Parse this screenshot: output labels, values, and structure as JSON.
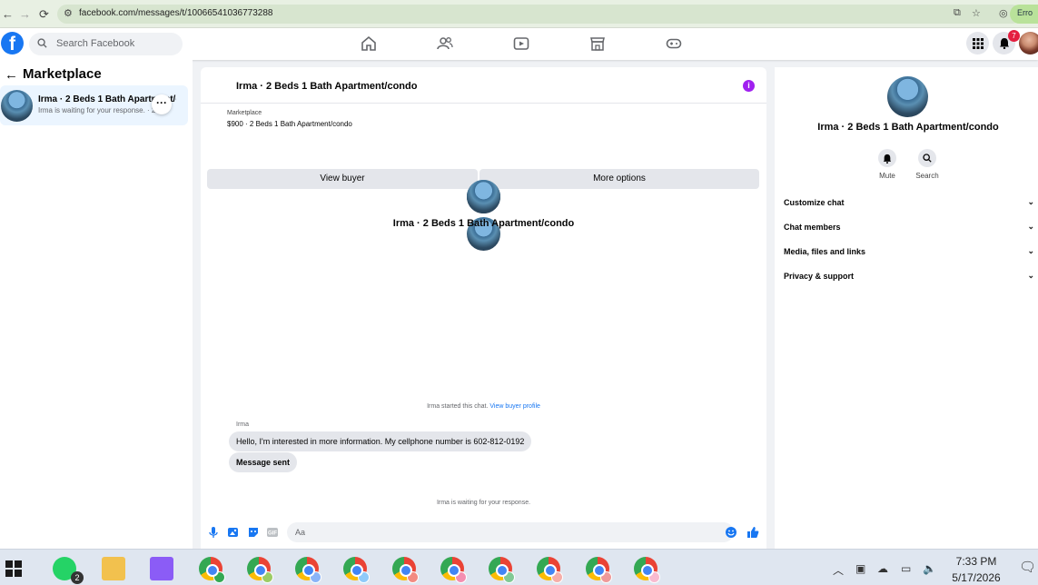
{
  "browser": {
    "url": "facebook.com/messages/t/100665410367732​88",
    "error_chip": "Erro"
  },
  "facebook": {
    "search_placeholder": "Search Facebook",
    "notification_count": "7"
  },
  "sidebar": {
    "title": "Marketplace",
    "conversation": {
      "title": "Irma · 2 Beds 1 Bath Apartment/condo",
      "preview": "Irma is waiting for your response. · 2d"
    }
  },
  "chat": {
    "header_title": "Irma · 2 Beds 1 Bath Apartment/condo",
    "listing_source": "Marketplace",
    "listing_price": "$900 · 2 Beds 1 Bath Apartment/condo",
    "view_buyer_label": "View buyer",
    "more_options_label": "More options",
    "profile_name": "Irma · 2 Beds 1 Bath Apartment/condo",
    "started_text": "Irma started this chat.",
    "view_buyer_profile_link": "View buyer profile",
    "sender_name": "Irma",
    "message_1": "Hello, I'm interested in more information. My cellphone number is 602-812-0192",
    "message_2": "Message sent",
    "waiting_text": "Irma is waiting for your response.",
    "compose_placeholder": "Aa"
  },
  "details": {
    "name": "Irma · 2 Beds 1 Bath Apartment/condo",
    "mute_label": "Mute",
    "search_label": "Search",
    "sections": [
      "Customize chat",
      "Chat members",
      "Media, files and links",
      "Privacy & support"
    ]
  },
  "taskbar": {
    "whatsapp_count": "2",
    "time": "7:33 PM",
    "date": "5/17/2026"
  }
}
